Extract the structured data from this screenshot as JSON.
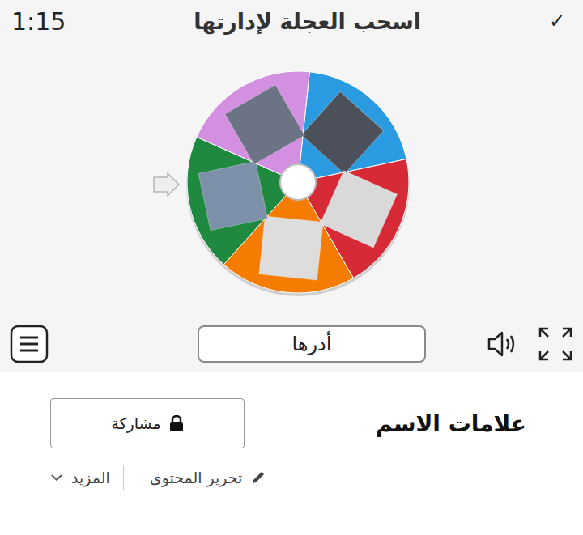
{
  "header": {
    "time": "1:15",
    "title": "اسحب العجلة لإدارتها",
    "check": "✓"
  },
  "wheel": {
    "segments": [
      {
        "color": "#2a9be0"
      },
      {
        "color": "#d62b36"
      },
      {
        "color": "#f57c00"
      },
      {
        "color": "#1f8a3f"
      },
      {
        "color": "#d38fe0"
      }
    ]
  },
  "controls": {
    "spin_button": "أدرها"
  },
  "activity": {
    "title": "علامات الاسم",
    "share_button": "مشاركة",
    "edit_link": "تحرير المحتوى",
    "more_link": "المزيد"
  }
}
